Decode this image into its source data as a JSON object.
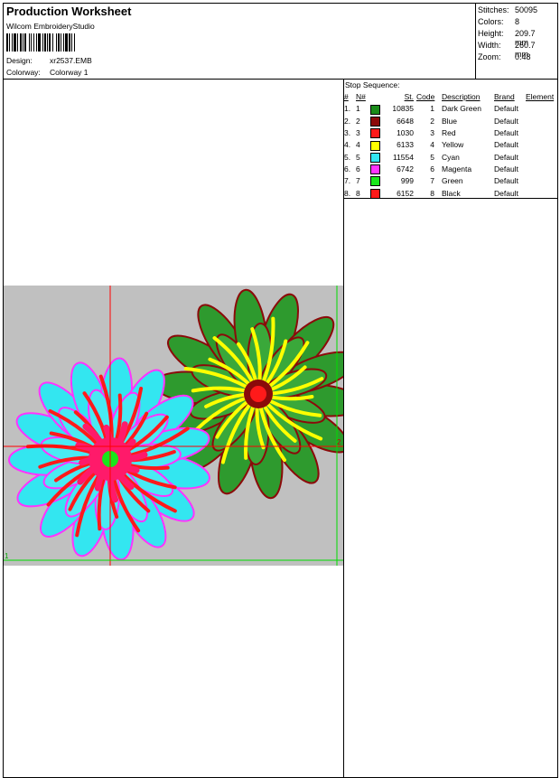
{
  "header": {
    "title": "Production Worksheet",
    "software": "Wilcom EmbroideryStudio",
    "design_label": "Design:",
    "design_value": "xr2537.EMB",
    "colorway_label": "Colorway:",
    "colorway_value": "Colorway 1"
  },
  "stats": {
    "stitches_label": "Stitches:",
    "stitches_value": "50095",
    "colors_label": "Colors:",
    "colors_value": "8",
    "height_label": "Height:",
    "height_value": "209.7 mm",
    "width_label": "Width:",
    "width_value": "260.7 mm",
    "zoom_label": "Zoom:",
    "zoom_value": "0.48"
  },
  "stop_sequence": {
    "title": "Stop Sequence:",
    "headers": [
      "#",
      "N#",
      "St.",
      "Code",
      "Description",
      "Brand",
      "Element"
    ],
    "rows": [
      {
        "num": "1.",
        "n": "1",
        "color": "#1a8c1a",
        "st": "10835",
        "code": "1",
        "desc": "Dark Green",
        "brand": "Default"
      },
      {
        "num": "2.",
        "n": "2",
        "color": "#8b0a0a",
        "st": "6648",
        "code": "2",
        "desc": "Blue",
        "brand": "Default"
      },
      {
        "num": "3.",
        "n": "3",
        "color": "#ff1a1a",
        "st": "1030",
        "code": "3",
        "desc": "Red",
        "brand": "Default"
      },
      {
        "num": "4.",
        "n": "4",
        "color": "#ffff00",
        "st": "6133",
        "code": "4",
        "desc": "Yellow",
        "brand": "Default"
      },
      {
        "num": "5.",
        "n": "5",
        "color": "#33e6f0",
        "st": "11554",
        "code": "5",
        "desc": "Cyan",
        "brand": "Default"
      },
      {
        "num": "6.",
        "n": "6",
        "color": "#ff33ff",
        "st": "6742",
        "code": "6",
        "desc": "Magenta",
        "brand": "Default"
      },
      {
        "num": "7.",
        "n": "7",
        "color": "#1ae61a",
        "st": "999",
        "code": "7",
        "desc": "Green",
        "brand": "Default"
      },
      {
        "num": "8.",
        "n": "8",
        "color": "#ff1a1a",
        "st": "6152",
        "code": "8",
        "desc": "Black",
        "brand": "Default"
      }
    ]
  },
  "preview": {
    "background": "#c0c0c0",
    "start_marker": "1",
    "end_marker": "2"
  }
}
